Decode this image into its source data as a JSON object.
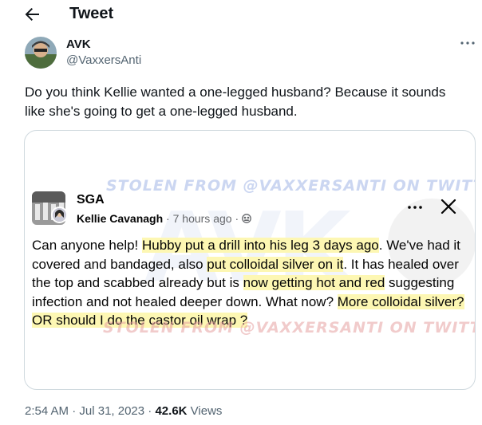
{
  "header": {
    "title": "Tweet",
    "back_icon": "arrow-left-icon"
  },
  "author": {
    "name": "AVK",
    "handle": "@VaxxersAnti",
    "more_icon": "more-horizontal-icon"
  },
  "tweet": {
    "text_line1": "Do you think Kellie wanted a one-legged husband?  Because it sounds",
    "text_line2": "like she's going to get a one-legged husband."
  },
  "media": {
    "watermark_top": "STOLEN FROM @VAXXERSANTI ON TWITTER",
    "watermark_bottom": "STOLEN FROM @VAXXERSANTI ON TWITTER",
    "watermark_big": "AVK",
    "fb_post": {
      "group_name": "SGA",
      "poster_name": "Kellie Cavanagh",
      "time": "7  hours ago",
      "segments": [
        {
          "text": "Can anyone help! ",
          "hl": false
        },
        {
          "text": "Hubby put a drill into his leg 3 days ago",
          "hl": true
        },
        {
          "text": ". We've had it covered and bandaged, also ",
          "hl": false
        },
        {
          "text": "put colloidal silver on it",
          "hl": true
        },
        {
          "text": ". It has healed over the top and scabbed already but is ",
          "hl": false
        },
        {
          "text": "now getting hot and red",
          "hl": true
        },
        {
          "text": " suggesting infection and not healed deeper down. What now? ",
          "hl": false
        },
        {
          "text": "More colloidal silver? OR should I do the castor oil wrap ?",
          "hl": true
        }
      ]
    }
  },
  "meta": {
    "time": "2:54 AM",
    "sep1": " · ",
    "date": "Jul 31, 2023",
    "sep2": " · ",
    "views": "42.6K",
    "views_label": " Views"
  },
  "colors": {
    "highlight": "#fdf7b3",
    "secondary_text": "#536471",
    "border": "#cfd9de"
  }
}
